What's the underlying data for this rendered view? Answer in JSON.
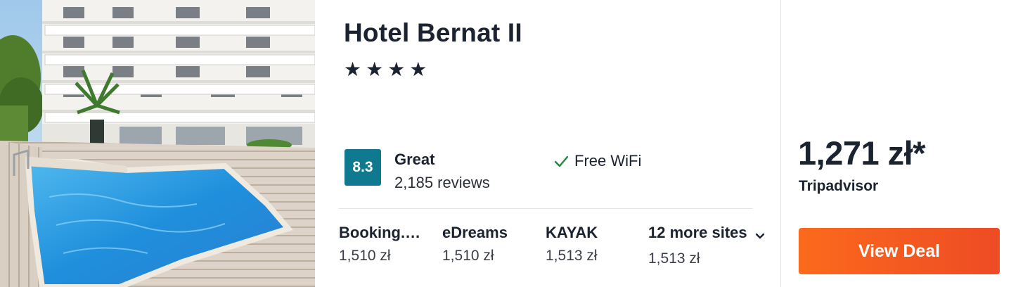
{
  "hotel": {
    "name": "Hotel Bernat II",
    "stars_text": "★★★★",
    "star_count": 4
  },
  "rating": {
    "score": "8.3",
    "label": "Great",
    "reviews": "2,185 reviews",
    "badge_color": "#0f7a8f"
  },
  "amenity": {
    "label": "Free WiFi",
    "icon": "check-icon",
    "icon_color": "#1f8a3e"
  },
  "sites": [
    {
      "name": "Booking.com",
      "price": "1,510 zł"
    },
    {
      "name": "eDreams",
      "price": "1,510 zł"
    },
    {
      "name": "KAYAK",
      "price": "1,513 zł"
    }
  ],
  "more_sites": {
    "label": "12 more sites",
    "price": "1,513 zł",
    "icon": "chevron-down-icon"
  },
  "deal": {
    "price": "1,271 zł*",
    "provider": "Tripadvisor",
    "button_label": "View Deal",
    "button_color": "#f25a22"
  }
}
